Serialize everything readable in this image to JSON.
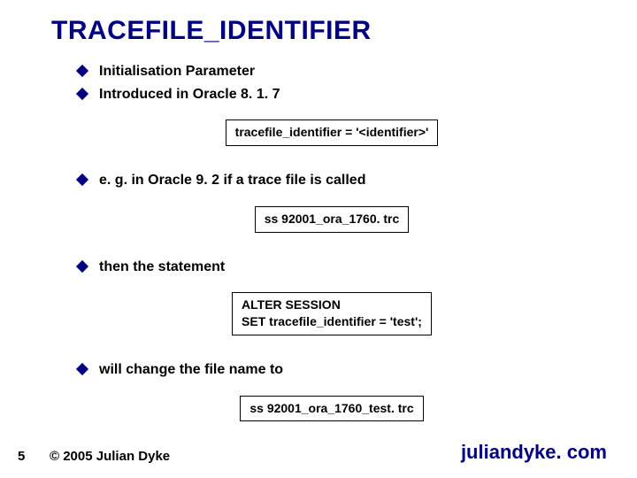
{
  "title": "TRACEFILE_IDENTIFIER",
  "bullets": {
    "b1": "Initialisation Parameter",
    "b2": "Introduced in Oracle 8. 1. 7",
    "b3": "e. g. in Oracle 9. 2 if a trace file is called",
    "b4": "then the statement",
    "b5": "will change the file name to"
  },
  "code": {
    "c1": "tracefile_identifier = '<identifier>'",
    "c2": "ss 92001_ora_1760. trc",
    "c3_line1": "ALTER SESSION",
    "c3_line2": "SET tracefile_identifier = 'test';",
    "c4": "ss 92001_ora_1760_test. trc"
  },
  "footer": {
    "page": "5",
    "copyright": "© 2005 Julian Dyke",
    "site": "juliandyke. com"
  }
}
